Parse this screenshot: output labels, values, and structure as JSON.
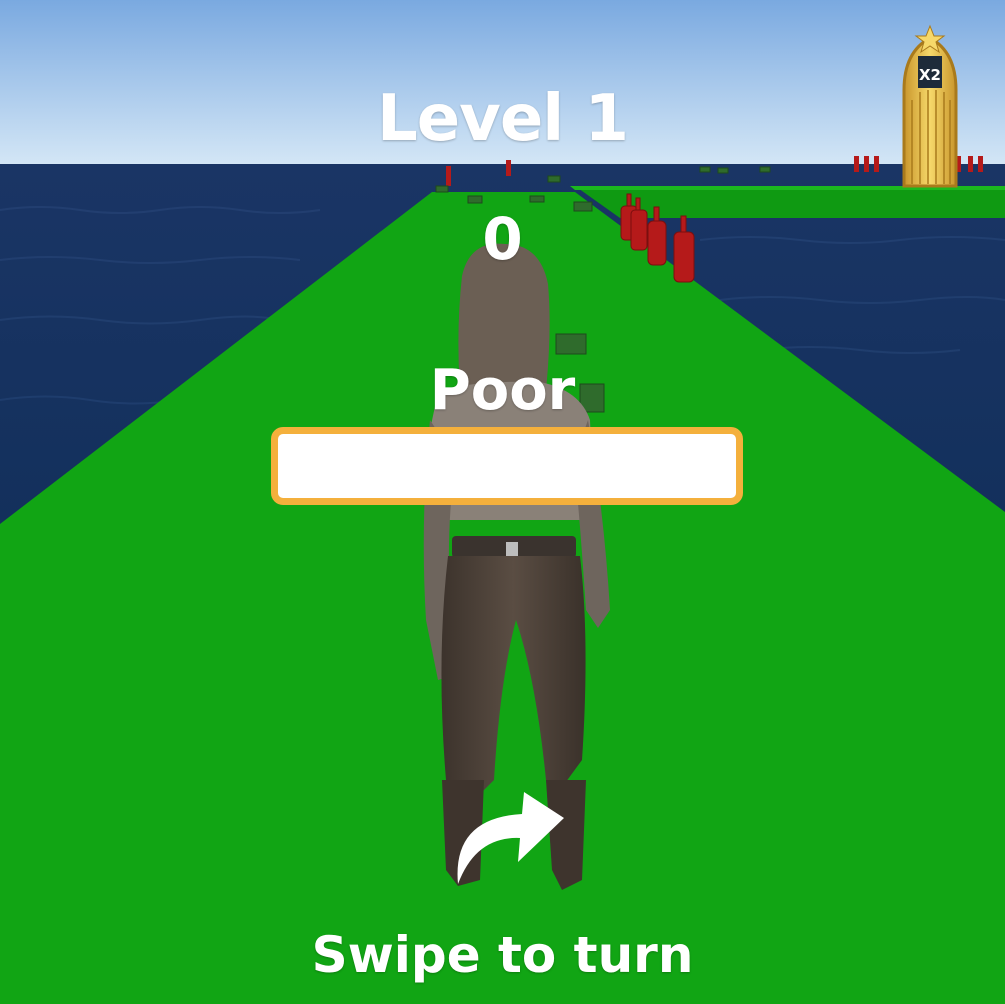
{
  "hud": {
    "level_label": "Level 1",
    "score": "0",
    "status_label": "Poor",
    "progress_fraction": 0,
    "hint": "Swipe to turn"
  },
  "gate": {
    "multiplier_label": "X2"
  },
  "icons": {
    "swipe": "curved-arrow-icon"
  },
  "colors": {
    "sky_top": "#7aa9e0",
    "sky_bottom": "#cfe3f5",
    "sea": "#14305e",
    "track": "#11a514",
    "progress_border": "#f4b03c",
    "bottle": "#b51a1a",
    "gate_gold": "#e8c04a"
  }
}
